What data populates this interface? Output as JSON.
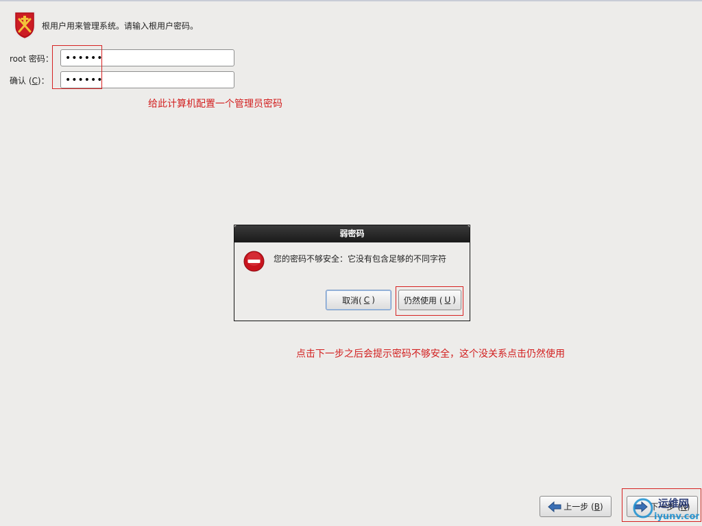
{
  "header": {
    "text": "根用户用来管理系统。请输入根用户密码。",
    "icon": "shield-emblem-icon"
  },
  "form": {
    "root_label": "root 密码：",
    "root_value": "••••••",
    "confirm_label_prefix": "确认 (",
    "confirm_label_key": "C",
    "confirm_label_suffix": ")：",
    "confirm_value": "••••••"
  },
  "annotations": {
    "note1": "给此计算机配置一个管理员密码",
    "note2": "点击下一步之后会提示密码不够安全，这个没关系点击仍然使用"
  },
  "dialog": {
    "title": "弱密码",
    "message": "您的密码不够安全：它没有包含足够的不同字符",
    "icon": "error-icon",
    "cancel_prefix": "取消(",
    "cancel_key": "C",
    "cancel_suffix": ")",
    "use_prefix": "仍然使用 (",
    "use_key": "U",
    "use_suffix": ")"
  },
  "nav": {
    "back_prefix": "上一步 (",
    "back_key": "B",
    "back_suffix": ")",
    "next_prefix": "下一步 (",
    "next_key": "N",
    "next_suffix": ")"
  },
  "watermark": {
    "line1": "运维网",
    "line2": "iyunv.com"
  },
  "colors": {
    "background": "#edecea",
    "annotation_red": "#d21e1e",
    "dialog_title_bg": "#1a1a1a",
    "error_red": "#c8141e",
    "back_arrow_blue": "#3a6fb5"
  }
}
